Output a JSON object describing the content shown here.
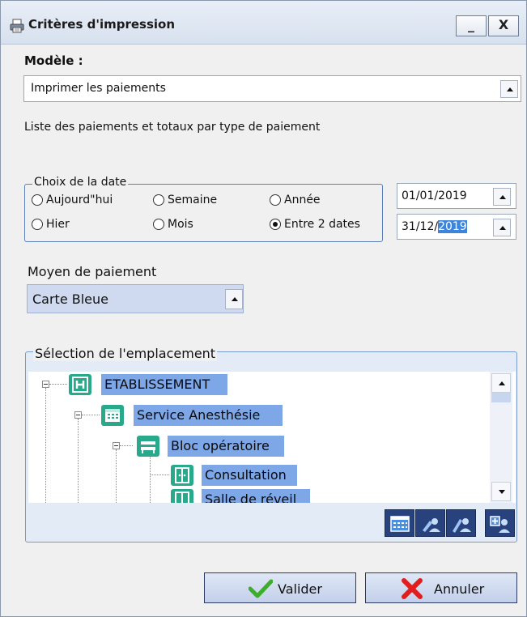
{
  "window": {
    "title": "Critères d'impression",
    "minimize_label": "_",
    "close_label": "X"
  },
  "model": {
    "label": "Modèle :",
    "value": "Imprimer les paiements",
    "description": "Liste des paiements et totaux par type de paiement"
  },
  "date_choice": {
    "legend": "Choix de la date",
    "options": [
      "Aujourd\"hui",
      "Semaine",
      "Année",
      "Hier",
      "Mois",
      "Entre 2 dates"
    ],
    "selected": "Entre 2 dates",
    "date_from": "01/01/2019",
    "date_to_prefix": "31/12/",
    "date_to_selected": "2019"
  },
  "payment": {
    "label": "Moyen de paiement",
    "value": "Carte Bleue"
  },
  "location": {
    "legend": "Sélection de l'emplacement",
    "tree": [
      {
        "label": "ETABLISSEMENT",
        "icon": "hospital-icon"
      },
      {
        "label": "Service Anesthésie",
        "icon": "calendar-grid-icon"
      },
      {
        "label": "Bloc opératoire",
        "icon": "bed-icon"
      },
      {
        "label": "Consultation",
        "icon": "door-icon"
      },
      {
        "label": "Salle de réveil",
        "icon": "door-icon"
      }
    ]
  },
  "buttons": {
    "validate": "Valider",
    "cancel": "Annuler"
  },
  "colors": {
    "selection_blue": "#7ea7e8",
    "teal_icon": "#29a98c",
    "toolbar_blue": "#27427d",
    "validate_green": "#3cae2a",
    "cancel_red": "#e11d1d"
  }
}
